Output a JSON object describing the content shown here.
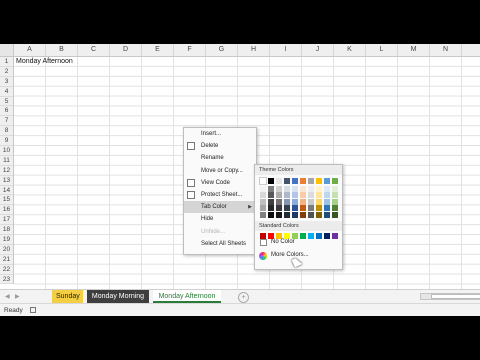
{
  "spreadsheet": {
    "columns": [
      "A",
      "B",
      "C",
      "D",
      "E",
      "F",
      "G",
      "H",
      "I",
      "J",
      "K",
      "L",
      "M",
      "N"
    ],
    "rows": [
      "1",
      "2",
      "3",
      "4",
      "5",
      "6",
      "7",
      "8",
      "9",
      "10",
      "11",
      "12",
      "13",
      "14",
      "15",
      "16",
      "17",
      "18",
      "19",
      "20",
      "21",
      "22",
      "23"
    ],
    "cell_a1": "Monday Afternoon"
  },
  "tabs": [
    {
      "label": "Sunday",
      "bg": "#f4cf44",
      "color": "#222222"
    },
    {
      "label": "Monday Morning",
      "bg": "#3e3e3e",
      "color": "#ffffff"
    },
    {
      "label": "Monday Afternoon",
      "bg": "#ffffff",
      "color": "#2a7a3a"
    }
  ],
  "status": {
    "ready": "Ready"
  },
  "context_menu": {
    "items": [
      {
        "label": "Insert...",
        "icon": "none",
        "disabled": false
      },
      {
        "label": "Delete",
        "icon": "delete-icon",
        "disabled": false
      },
      {
        "label": "Rename",
        "icon": "none",
        "disabled": false
      },
      {
        "label": "Move or Copy...",
        "icon": "none",
        "disabled": false
      },
      {
        "label": "View Code",
        "icon": "view-code-icon",
        "disabled": false
      },
      {
        "label": "Protect Sheet...",
        "icon": "protect-sheet-icon",
        "disabled": false
      },
      {
        "label": "Tab Color",
        "icon": "none",
        "disabled": false,
        "submenu": true,
        "highlighted": true
      },
      {
        "label": "Hide",
        "icon": "none",
        "disabled": false
      },
      {
        "label": "Unhide...",
        "icon": "none",
        "disabled": true
      },
      {
        "label": "Select All Sheets",
        "icon": "none",
        "disabled": false
      }
    ]
  },
  "color_picker": {
    "theme_header": "Theme Colors",
    "standard_header": "Standard Colors",
    "no_color": "No Color",
    "more_colors": "More Colors...",
    "theme_colors": [
      [
        "#ffffff",
        "#f2f2f2",
        "#d9d9d9",
        "#bfbfbf",
        "#a6a6a6",
        "#7f7f7f"
      ],
      [
        "#000000",
        "#7f7f7f",
        "#595959",
        "#404040",
        "#262626",
        "#0d0d0d"
      ],
      [
        "#e7e6e6",
        "#d0cece",
        "#aeabab",
        "#757171",
        "#3a3838",
        "#161616"
      ],
      [
        "#44546a",
        "#d6dce4",
        "#adb9ca",
        "#8496b0",
        "#333f4f",
        "#222a35"
      ],
      [
        "#4472c4",
        "#d9e2f3",
        "#b4c6e7",
        "#8eaadb",
        "#2f5496",
        "#1f3864"
      ],
      [
        "#ed7d31",
        "#fbe5d5",
        "#f7cbac",
        "#f4b183",
        "#c55a11",
        "#843c0b"
      ],
      [
        "#a5a5a5",
        "#ededed",
        "#dbdbdb",
        "#c9c9c9",
        "#7b7b7b",
        "#525252"
      ],
      [
        "#ffc000",
        "#fff2cc",
        "#fee599",
        "#ffd965",
        "#bf9000",
        "#7f6000"
      ],
      [
        "#5b9bd5",
        "#deebf6",
        "#bdd7ee",
        "#9cc2e5",
        "#2e75b5",
        "#1f4e79"
      ],
      [
        "#70ad47",
        "#e2efd9",
        "#c5e0b3",
        "#a8d08d",
        "#538135",
        "#375623"
      ]
    ],
    "standard_colors": [
      "#c00000",
      "#ff0000",
      "#ffc000",
      "#ffff00",
      "#92d050",
      "#00b050",
      "#00b0f0",
      "#0070c0",
      "#002060",
      "#7030a0"
    ]
  }
}
